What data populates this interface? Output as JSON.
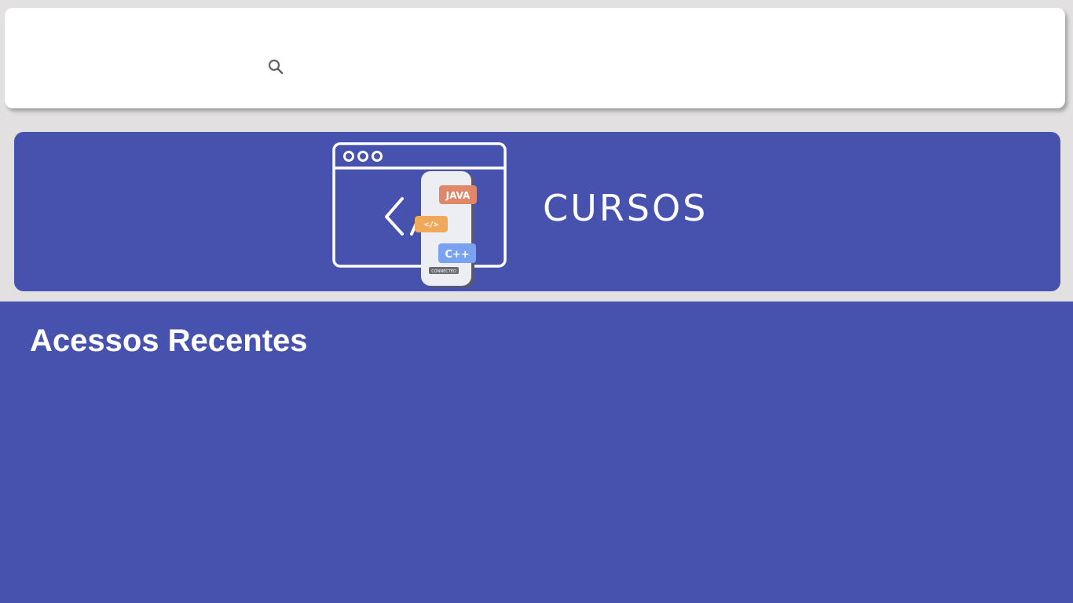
{
  "search": {
    "icon": "search-icon",
    "value": "",
    "placeholder": ""
  },
  "banner": {
    "title": "CURSOS",
    "illustration": {
      "badges": [
        "JAVA",
        "</>",
        "C++"
      ],
      "phone_label": "CONNECTED"
    }
  },
  "recent": {
    "title": "Acessos Recentes"
  },
  "colors": {
    "background": "#e2e0e0",
    "primary": "#4652ad",
    "card": "#ffffff",
    "java_badge": "#e0876a",
    "code_badge": "#f0a85a",
    "cpp_badge": "#7aa2f0"
  }
}
